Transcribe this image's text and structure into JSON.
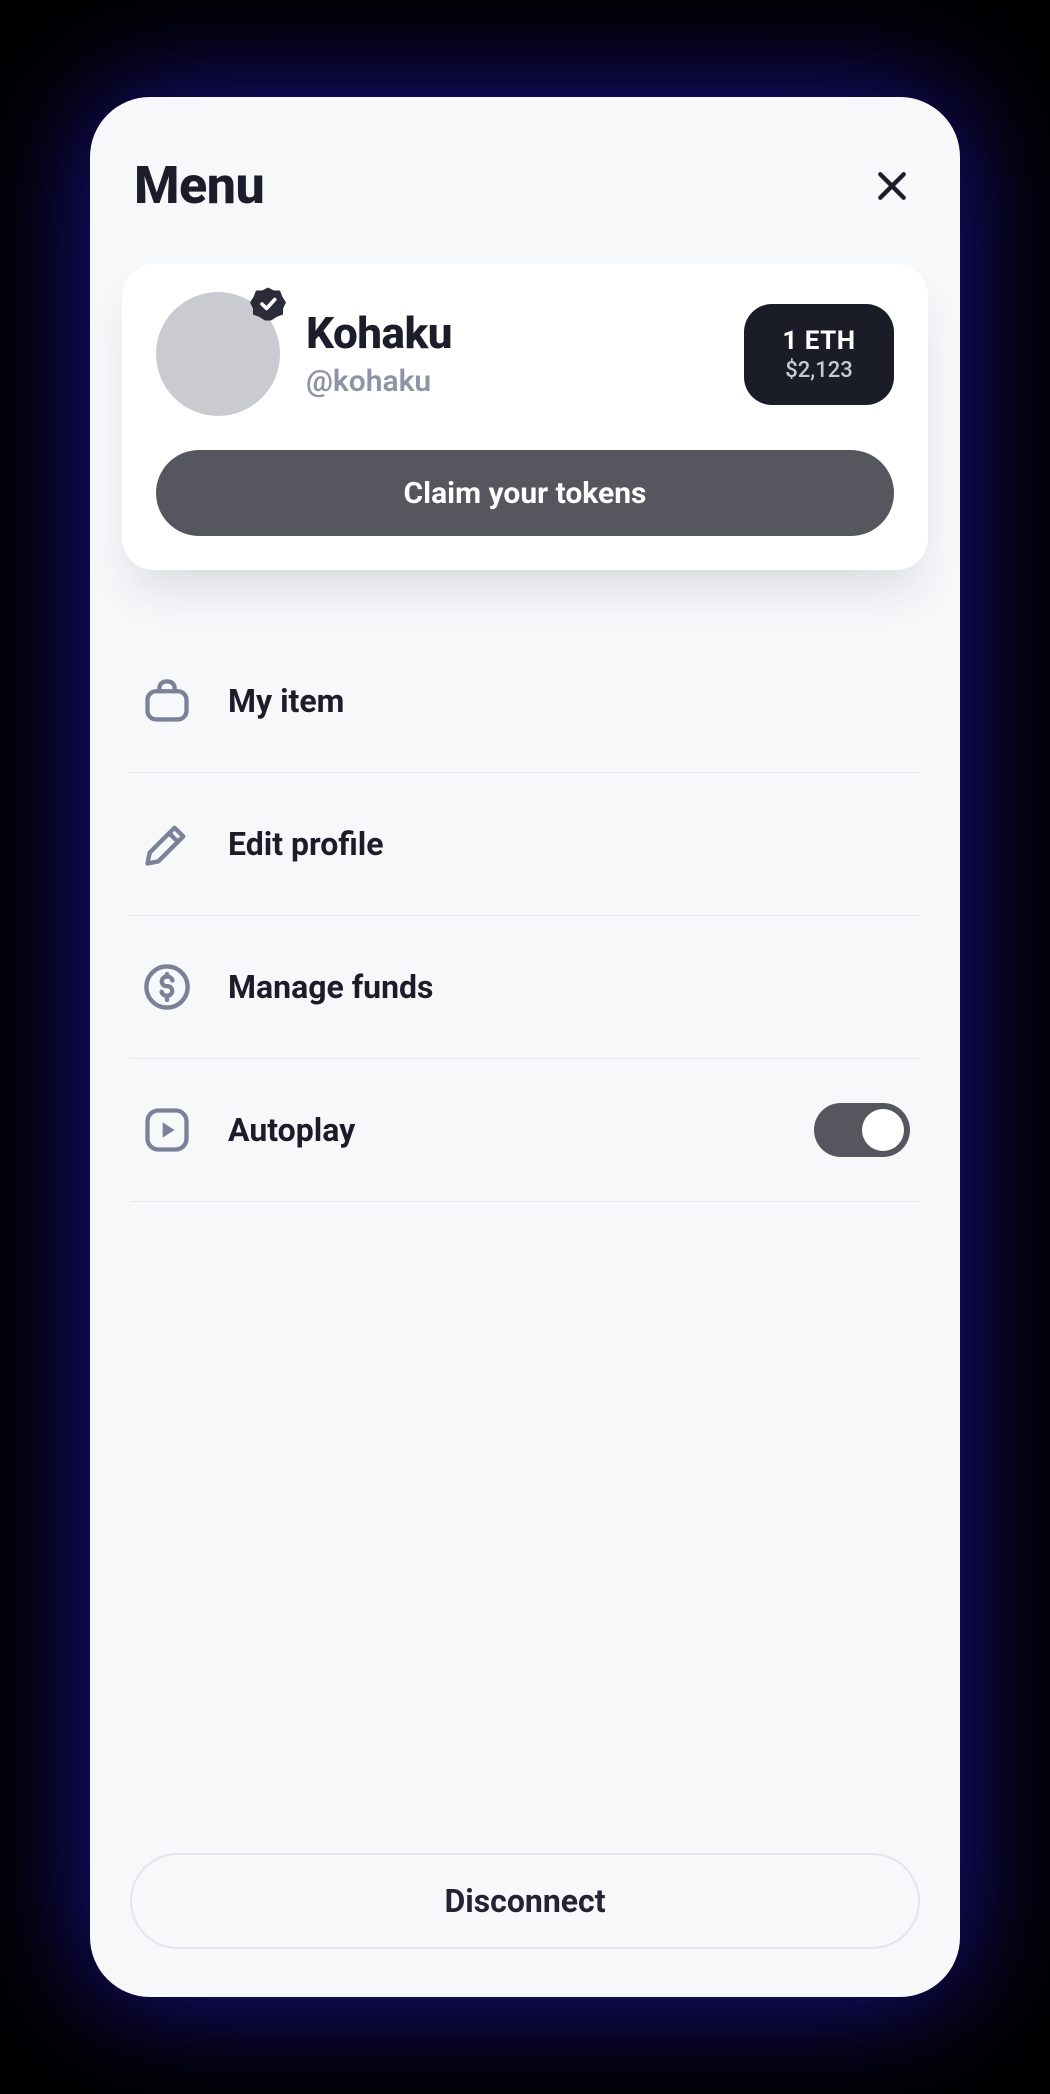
{
  "header": {
    "title": "Menu"
  },
  "profile": {
    "name": "Kohaku",
    "handle": "@kohaku",
    "balance_primary": "1 ETH",
    "balance_secondary": "$2,123",
    "cta_label": "Claim your tokens"
  },
  "menu": {
    "items": [
      {
        "icon": "briefcase-icon",
        "label": "My item"
      },
      {
        "icon": "pencil-icon",
        "label": "Edit profile"
      },
      {
        "icon": "dollar-circle-icon",
        "label": "Manage funds"
      },
      {
        "icon": "play-square-icon",
        "label": "Autoplay",
        "toggle": true,
        "toggle_on": true
      }
    ]
  },
  "footer": {
    "disconnect_label": "Disconnect"
  }
}
